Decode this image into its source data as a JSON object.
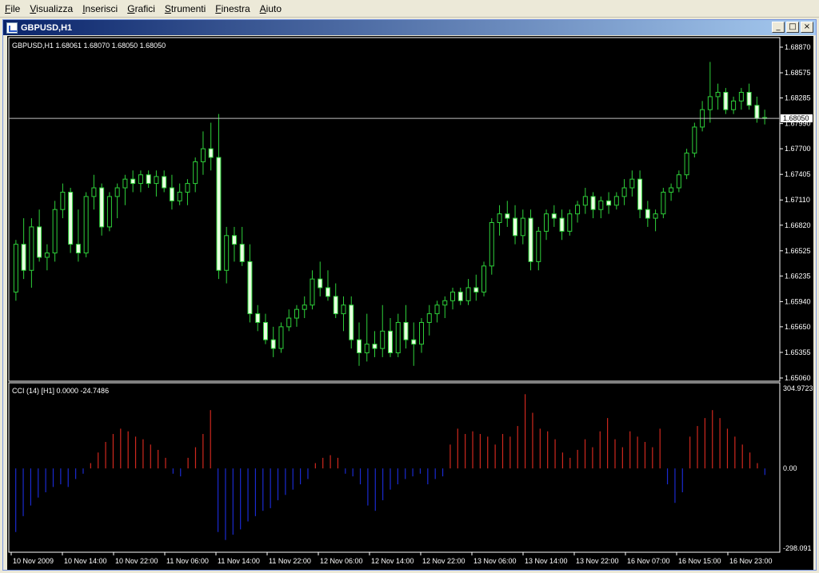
{
  "menu": [
    "File",
    "Visualizza",
    "Inserisci",
    "Grafici",
    "Strumenti",
    "Finestra",
    "Aiuto"
  ],
  "window": {
    "title": "GBPUSD,H1",
    "min_icon": "minimize-icon",
    "max_icon": "maximize-icon",
    "close_icon": "close-icon"
  },
  "price_panel": {
    "header": "GBPUSD,H1  1.68061 1.68070 1.68050 1.68050",
    "current_price": "1.68050",
    "price_labels": [
      "1.68870",
      "1.68575",
      "1.68285",
      "1.67990",
      "1.67700",
      "1.67405",
      "1.67110",
      "1.66820",
      "1.66525",
      "1.66235",
      "1.65940",
      "1.65650",
      "1.65355",
      "1.65060"
    ],
    "colors": {
      "up_body": "#000000",
      "down_body": "#e8ffe0",
      "wick": "#2ed03a",
      "price_line": "#c0c0c0"
    }
  },
  "cci_panel": {
    "header": "CCI (14) [H1]  0.0000 -24.7486",
    "max_label": "304.9723",
    "zero_label": "0.00",
    "min_label": "-298.091",
    "colors": {
      "positive": "#d0281e",
      "negative": "#1a2ad0"
    }
  },
  "time_labels": [
    "10 Nov 2009",
    "10 Nov 14:00",
    "10 Nov 22:00",
    "11 Nov 06:00",
    "11 Nov 14:00",
    "11 Nov 22:00",
    "12 Nov 06:00",
    "12 Nov 14:00",
    "12 Nov 22:00",
    "13 Nov 06:00",
    "13 Nov 14:00",
    "13 Nov 22:00",
    "16 Nov 07:00",
    "16 Nov 15:00",
    "16 Nov 23:00"
  ],
  "chart_data": {
    "type": "candlestick",
    "symbol": "GBPUSD",
    "timeframe": "H1",
    "ylim": [
      1.6506,
      1.6887
    ],
    "ohlc": [
      [
        1.6605,
        1.6665,
        1.6595,
        1.666
      ],
      [
        1.666,
        1.669,
        1.662,
        1.663
      ],
      [
        1.663,
        1.669,
        1.661,
        1.668
      ],
      [
        1.668,
        1.67,
        1.664,
        1.6645
      ],
      [
        1.6645,
        1.666,
        1.663,
        1.665
      ],
      [
        1.665,
        1.671,
        1.664,
        1.67
      ],
      [
        1.67,
        1.673,
        1.669,
        1.672
      ],
      [
        1.672,
        1.6725,
        1.665,
        1.666
      ],
      [
        1.666,
        1.67,
        1.664,
        1.665
      ],
      [
        1.665,
        1.672,
        1.6645,
        1.6715
      ],
      [
        1.6715,
        1.674,
        1.67,
        1.6725
      ],
      [
        1.6725,
        1.673,
        1.667,
        1.668
      ],
      [
        1.668,
        1.672,
        1.6675,
        1.6715
      ],
      [
        1.6715,
        1.673,
        1.669,
        1.6725
      ],
      [
        1.6725,
        1.674,
        1.6705,
        1.6735
      ],
      [
        1.6735,
        1.6745,
        1.672,
        1.673
      ],
      [
        1.673,
        1.6745,
        1.672,
        1.674
      ],
      [
        1.674,
        1.6745,
        1.6725,
        1.673
      ],
      [
        1.673,
        1.6745,
        1.6715,
        1.6738
      ],
      [
        1.6738,
        1.6745,
        1.672,
        1.6725
      ],
      [
        1.6725,
        1.674,
        1.67,
        1.671
      ],
      [
        1.671,
        1.673,
        1.6705,
        1.672
      ],
      [
        1.672,
        1.6735,
        1.6705,
        1.673
      ],
      [
        1.673,
        1.676,
        1.672,
        1.6755
      ],
      [
        1.6755,
        1.679,
        1.674,
        1.677
      ],
      [
        1.677,
        1.68,
        1.6745,
        1.676
      ],
      [
        1.676,
        1.681,
        1.662,
        1.663
      ],
      [
        1.663,
        1.668,
        1.6615,
        1.667
      ],
      [
        1.667,
        1.668,
        1.664,
        1.666
      ],
      [
        1.666,
        1.668,
        1.6635,
        1.664
      ],
      [
        1.664,
        1.666,
        1.657,
        1.658
      ],
      [
        1.658,
        1.659,
        1.656,
        1.657
      ],
      [
        1.657,
        1.658,
        1.6545,
        1.655
      ],
      [
        1.655,
        1.6565,
        1.653,
        1.654
      ],
      [
        1.654,
        1.657,
        1.6535,
        1.6565
      ],
      [
        1.6565,
        1.6585,
        1.656,
        1.6575
      ],
      [
        1.6575,
        1.659,
        1.6565,
        1.6585
      ],
      [
        1.6585,
        1.66,
        1.6575,
        1.659
      ],
      [
        1.659,
        1.663,
        1.6585,
        1.662
      ],
      [
        1.662,
        1.664,
        1.66,
        1.661
      ],
      [
        1.661,
        1.663,
        1.6595,
        1.66
      ],
      [
        1.66,
        1.6615,
        1.6575,
        1.658
      ],
      [
        1.658,
        1.66,
        1.656,
        1.659
      ],
      [
        1.659,
        1.66,
        1.654,
        1.655
      ],
      [
        1.655,
        1.657,
        1.652,
        1.6535
      ],
      [
        1.6535,
        1.658,
        1.6525,
        1.6545
      ],
      [
        1.6545,
        1.656,
        1.653,
        1.654
      ],
      [
        1.654,
        1.659,
        1.653,
        1.656
      ],
      [
        1.656,
        1.6575,
        1.653,
        1.6535
      ],
      [
        1.6535,
        1.658,
        1.653,
        1.657
      ],
      [
        1.657,
        1.659,
        1.654,
        1.655
      ],
      [
        1.655,
        1.657,
        1.652,
        1.6545
      ],
      [
        1.6545,
        1.6575,
        1.6535,
        1.657
      ],
      [
        1.657,
        1.659,
        1.6555,
        1.658
      ],
      [
        1.658,
        1.6595,
        1.657,
        1.659
      ],
      [
        1.659,
        1.66,
        1.6575,
        1.6595
      ],
      [
        1.6595,
        1.661,
        1.6585,
        1.6605
      ],
      [
        1.6605,
        1.661,
        1.659,
        1.6595
      ],
      [
        1.6595,
        1.662,
        1.659,
        1.661
      ],
      [
        1.661,
        1.6625,
        1.6595,
        1.6605
      ],
      [
        1.6605,
        1.664,
        1.66,
        1.6635
      ],
      [
        1.6635,
        1.669,
        1.6625,
        1.6685
      ],
      [
        1.6685,
        1.6705,
        1.667,
        1.6695
      ],
      [
        1.6695,
        1.671,
        1.668,
        1.669
      ],
      [
        1.669,
        1.6705,
        1.666,
        1.667
      ],
      [
        1.667,
        1.67,
        1.666,
        1.669
      ],
      [
        1.669,
        1.67,
        1.663,
        1.664
      ],
      [
        1.664,
        1.668,
        1.663,
        1.6675
      ],
      [
        1.6675,
        1.67,
        1.6665,
        1.6695
      ],
      [
        1.6695,
        1.6705,
        1.668,
        1.669
      ],
      [
        1.669,
        1.67,
        1.6665,
        1.6675
      ],
      [
        1.6675,
        1.67,
        1.667,
        1.6695
      ],
      [
        1.6695,
        1.671,
        1.6685,
        1.6705
      ],
      [
        1.6705,
        1.6725,
        1.6695,
        1.6715
      ],
      [
        1.6715,
        1.672,
        1.669,
        1.67
      ],
      [
        1.67,
        1.6715,
        1.669,
        1.671
      ],
      [
        1.671,
        1.672,
        1.6695,
        1.6705
      ],
      [
        1.6705,
        1.672,
        1.67,
        1.6715
      ],
      [
        1.6715,
        1.6735,
        1.6705,
        1.6725
      ],
      [
        1.6725,
        1.6745,
        1.6715,
        1.6735
      ],
      [
        1.6735,
        1.6745,
        1.669,
        1.67
      ],
      [
        1.67,
        1.671,
        1.668,
        1.669
      ],
      [
        1.669,
        1.67,
        1.6675,
        1.6695
      ],
      [
        1.6695,
        1.6725,
        1.669,
        1.672
      ],
      [
        1.672,
        1.673,
        1.671,
        1.6725
      ],
      [
        1.6725,
        1.6745,
        1.672,
        1.674
      ],
      [
        1.674,
        1.677,
        1.6735,
        1.6765
      ],
      [
        1.6765,
        1.68,
        1.676,
        1.6795
      ],
      [
        1.6795,
        1.6825,
        1.679,
        1.6815
      ],
      [
        1.6815,
        1.687,
        1.68,
        1.683
      ],
      [
        1.683,
        1.6845,
        1.6815,
        1.6835
      ],
      [
        1.6835,
        1.684,
        1.681,
        1.6815
      ],
      [
        1.6815,
        1.683,
        1.681,
        1.6825
      ],
      [
        1.6825,
        1.684,
        1.6815,
        1.6835
      ],
      [
        1.6835,
        1.6845,
        1.6815,
        1.682
      ],
      [
        1.682,
        1.683,
        1.68,
        1.6805
      ],
      [
        1.6805,
        1.6815,
        1.6798,
        1.6806
      ]
    ],
    "cci": [
      -240,
      -180,
      -140,
      -110,
      -90,
      -70,
      -60,
      -70,
      -40,
      -20,
      20,
      60,
      100,
      130,
      150,
      140,
      120,
      110,
      90,
      70,
      40,
      -20,
      -30,
      40,
      80,
      130,
      220,
      -240,
      -270,
      -250,
      -230,
      -200,
      -180,
      -160,
      -150,
      -120,
      -100,
      -80,
      -60,
      -40,
      20,
      40,
      50,
      40,
      -20,
      -30,
      -60,
      -140,
      -160,
      -120,
      -80,
      -60,
      -40,
      -30,
      -20,
      -60,
      -40,
      -30,
      90,
      150,
      130,
      140,
      130,
      120,
      90,
      130,
      120,
      160,
      280,
      210,
      150,
      140,
      110,
      60,
      40,
      70,
      110,
      80,
      140,
      190,
      110,
      80,
      140,
      120,
      100,
      80,
      150,
      -60,
      -130,
      -90,
      120,
      160,
      190,
      220,
      190,
      150,
      120,
      90,
      60,
      20,
      -24.7486
    ]
  }
}
